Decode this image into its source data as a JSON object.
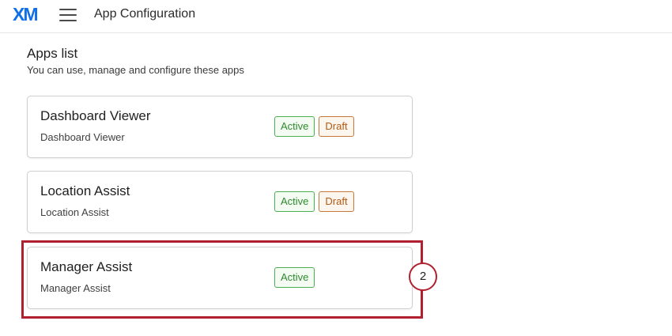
{
  "header": {
    "logo_text": "XM",
    "title": "App Configuration",
    "menu_icon": "hamburger-menu-icon"
  },
  "apps_list": {
    "title": "Apps list",
    "subtitle": "You can use, manage and configure these apps",
    "apps": [
      {
        "name": "Dashboard Viewer",
        "description": "Dashboard Viewer",
        "badges": [
          "Active",
          "Draft"
        ]
      },
      {
        "name": "Location Assist",
        "description": "Location Assist",
        "badges": [
          "Active",
          "Draft"
        ]
      },
      {
        "name": "Manager Assist",
        "description": "Manager Assist",
        "badges": [
          "Active"
        ]
      }
    ]
  },
  "annotation": {
    "step_number": "2",
    "color": "#b0202e"
  },
  "colors": {
    "brand": "#1170e8",
    "active": "#2e8b2e",
    "draft": "#b35a12"
  }
}
